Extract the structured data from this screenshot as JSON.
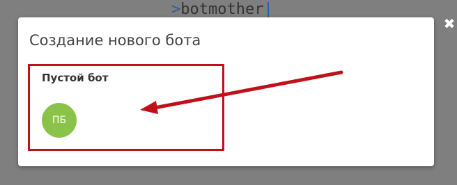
{
  "background": {
    "logo_prefix": ">",
    "logo_text": "botmother",
    "logo_cursor": "|"
  },
  "close": {
    "glyph": "✖"
  },
  "modal": {
    "title": "Создание нового бота",
    "cards": [
      {
        "title": "Пустой бот",
        "avatar_text": "ПБ",
        "avatar_color": "#8bc34a",
        "highlight_color": "#c0101a"
      }
    ]
  },
  "annotation": {
    "arrow_color": "#c0101a"
  }
}
